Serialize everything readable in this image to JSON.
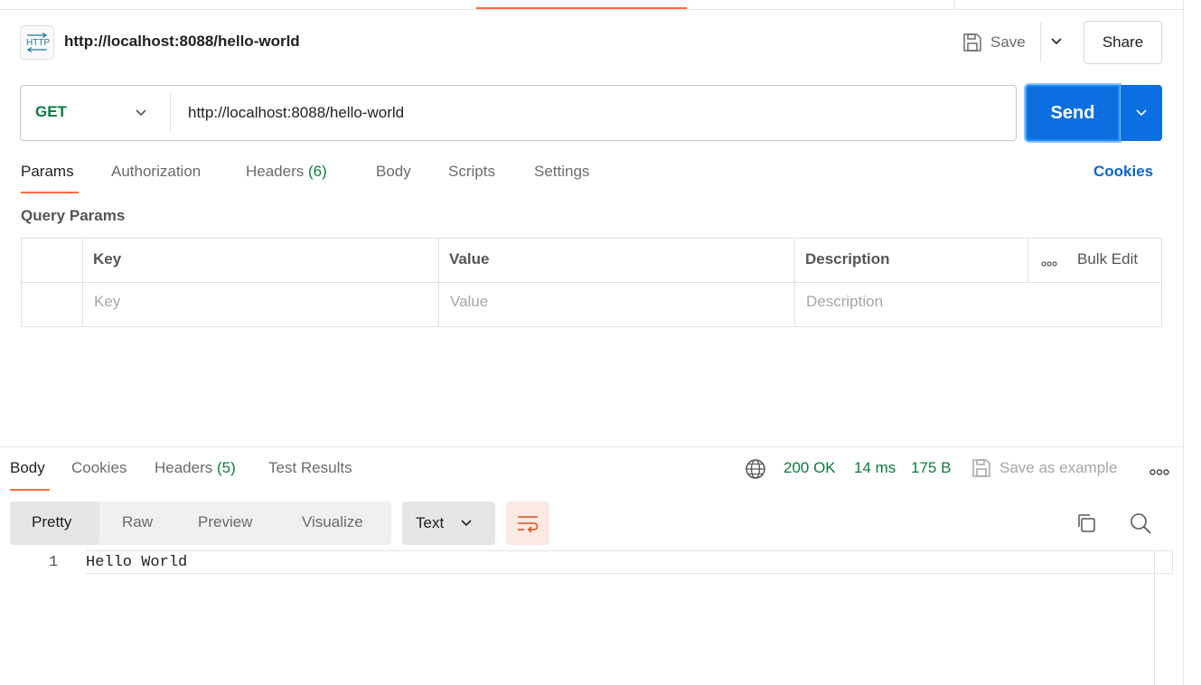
{
  "request": {
    "title": "http://localhost:8088/hello-world",
    "icon_label": "HTTP",
    "save_label": "Save",
    "share_label": "Share",
    "method": "GET",
    "url": "http://localhost:8088/hello-world",
    "send_label": "Send"
  },
  "request_tabs": {
    "params": "Params",
    "authorization": "Authorization",
    "headers": "Headers",
    "headers_count": "(6)",
    "body": "Body",
    "scripts": "Scripts",
    "settings": "Settings",
    "cookies": "Cookies",
    "active": "Params"
  },
  "query_params": {
    "title": "Query Params",
    "columns": {
      "key": "Key",
      "value": "Value",
      "description": "Description",
      "bulk_edit": "Bulk Edit"
    },
    "placeholders": {
      "key": "Key",
      "value": "Value",
      "description": "Description"
    }
  },
  "response": {
    "tabs": {
      "body": "Body",
      "cookies": "Cookies",
      "headers": "Headers",
      "headers_count": "(5)",
      "test_results": "Test Results",
      "active": "Body"
    },
    "status": "200 OK",
    "time": "14 ms",
    "size": "175 B",
    "save_as_example": "Save as example",
    "views": {
      "pretty": "Pretty",
      "raw": "Raw",
      "preview": "Preview",
      "visualize": "Visualize",
      "active": "Pretty"
    },
    "format": "Text",
    "lines": [
      {
        "number": "1",
        "text": "Hello World"
      }
    ]
  },
  "icons": {
    "http": "http-icon",
    "save": "save-icon",
    "chevron": "chevron-down-icon",
    "globe": "globe-icon",
    "more": "more-horizontal-icon",
    "wrap": "wrap-lines-icon",
    "copy": "copy-icon",
    "search": "search-icon"
  },
  "colors": {
    "accent": "#ff6c37",
    "send": "#0c6fe0",
    "success": "#0a7b3e",
    "link": "#0b66cc"
  }
}
